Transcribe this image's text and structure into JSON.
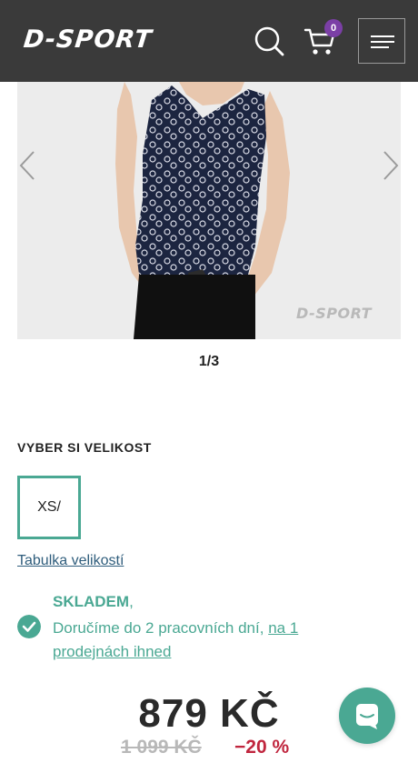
{
  "header": {
    "logo": "D-SPORT",
    "cart_count": "0",
    "icons": {
      "search": "search-icon",
      "cart": "cart-icon",
      "menu": "hamburger-menu-icon"
    },
    "background": "#3a3a3a"
  },
  "gallery": {
    "watermark": "D-SPORT",
    "counter": "1/3",
    "icons": {
      "prev": "chevron-left-icon",
      "next": "chevron-right-icon"
    }
  },
  "size": {
    "heading": "VYBER SI VELIKOST",
    "options": [
      "XS/"
    ],
    "table_link": "Tabulka velikostí"
  },
  "stock": {
    "status": "SKLADEM",
    "comma": ",",
    "delivery_text": "Doručíme do 2 pracovních dní,",
    "delivery_link": "na 1 prodejnách ihned"
  },
  "price": {
    "current": "879 KČ",
    "old": "1 099 KČ",
    "discount": "−20 %"
  },
  "colors": {
    "accent": "#4aa893",
    "badge": "#7b3fa6",
    "discount": "#c0263e"
  },
  "chat": {
    "icon": "chat-icon"
  }
}
